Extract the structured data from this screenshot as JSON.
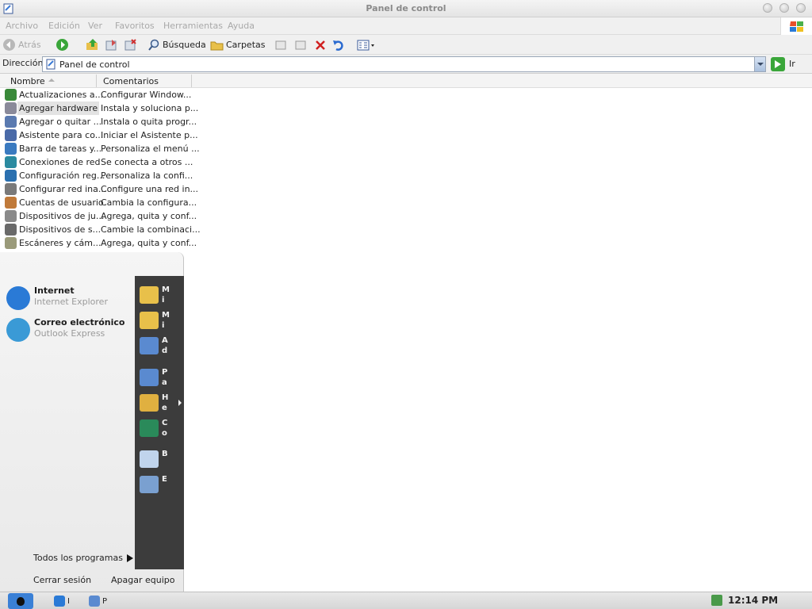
{
  "window": {
    "title": "Panel de control",
    "menu": [
      "Archivo",
      "Edición",
      "Ver",
      "Favoritos",
      "Herramientas",
      "Ayuda"
    ]
  },
  "toolbar": {
    "back_label": "Atrás",
    "search_label": "Búsqueda",
    "folders_label": "Carpetas"
  },
  "address": {
    "label": "Dirección",
    "value": "Panel de control",
    "go_label": "Ir"
  },
  "list": {
    "columns": [
      "Nombre",
      "Comentarios"
    ],
    "rows": [
      {
        "name": "Actualizaciones a...",
        "comment": "Configurar Window...",
        "icon": "update-icon",
        "color": "#3a8a3a"
      },
      {
        "name": "Agregar hardware",
        "comment": "Instala y soluciona p...",
        "icon": "hardware-icon",
        "color": "#8a8a9a"
      },
      {
        "name": "Agregar o quitar ...",
        "comment": "Instala o quita progr...",
        "icon": "add-remove-icon",
        "color": "#5a7ab0"
      },
      {
        "name": "Asistente para co...",
        "comment": "Iniciar el Asistente p...",
        "icon": "wizard-icon",
        "color": "#4a6aa8"
      },
      {
        "name": "Barra de tareas y...",
        "comment": "Personaliza el menú ...",
        "icon": "taskbar-icon",
        "color": "#3a7ac0"
      },
      {
        "name": "Conexiones de red",
        "comment": "Se conecta a otros ...",
        "icon": "network-icon",
        "color": "#2a8aa0"
      },
      {
        "name": "Configuración reg...",
        "comment": "Personaliza la confi...",
        "icon": "region-icon",
        "color": "#2a70b0"
      },
      {
        "name": "Configurar red ina...",
        "comment": "Configure una red in...",
        "icon": "wireless-icon",
        "color": "#7a7a7a"
      },
      {
        "name": "Cuentas de usuario",
        "comment": "Cambia la configura...",
        "icon": "users-icon",
        "color": "#c07a3a"
      },
      {
        "name": "Dispositivos de ju...",
        "comment": "Agrega, quita y conf...",
        "icon": "gamepad-icon",
        "color": "#8a8a8a"
      },
      {
        "name": "Dispositivos de s...",
        "comment": "Cambie la combinaci...",
        "icon": "sound-icon",
        "color": "#6a6a6a"
      },
      {
        "name": "Escáneres y cám...",
        "comment": "Agrega, quita y conf...",
        "icon": "scanner-icon",
        "color": "#9a9a7a"
      }
    ]
  },
  "startmenu": {
    "pinned": [
      {
        "title": "Internet",
        "subtitle": "Internet Explorer",
        "icon": "internet-explorer-icon",
        "color": "#2a7ad6"
      },
      {
        "title": "Correo electrónico",
        "subtitle": "Outlook Express",
        "icon": "outlook-express-icon",
        "color": "#3a9ad6"
      }
    ],
    "all_programs": "Todos los programas",
    "right_items": [
      {
        "label": "Mi",
        "icon": "my-documents-icon",
        "color": "#e8c04a"
      },
      {
        "label": "Mi",
        "icon": "my-music-icon",
        "color": "#e8c04a"
      },
      {
        "label": "Ad",
        "icon": "admin-tools-icon",
        "color": "#5a8ad0"
      },
      {
        "label": "Pa",
        "icon": "control-panel-icon",
        "color": "#5a8ad0"
      },
      {
        "label": "He",
        "icon": "tools-folder-icon",
        "color": "#e0b040"
      },
      {
        "label": "Co",
        "icon": "connect-icon",
        "color": "#2a8a5a"
      },
      {
        "label": "B",
        "icon": "search-icon",
        "color": "#c0d4ec"
      },
      {
        "label": "E",
        "icon": "run-icon",
        "color": "#7aa0d0"
      }
    ],
    "logoff": "Cerrar sesión",
    "shutdown": "Apagar equipo"
  },
  "taskbar": {
    "tasks": [
      {
        "label": "I",
        "icon": "ie-task-icon"
      },
      {
        "label": "P",
        "icon": "control-panel-task-icon"
      }
    ],
    "clock": "12:14 PM"
  }
}
